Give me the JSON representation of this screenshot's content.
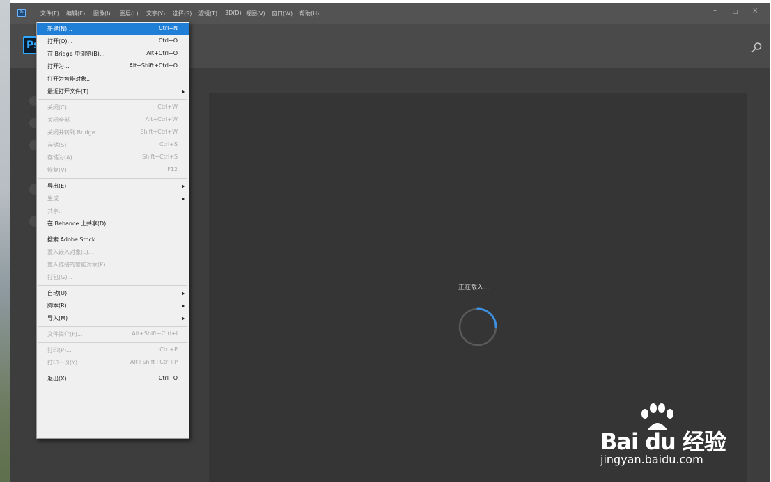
{
  "menubar": {
    "app_badge": "Ps",
    "items": [
      {
        "label": "文件(F)"
      },
      {
        "label": "编辑(E)"
      },
      {
        "label": "图像(I)"
      },
      {
        "label": "图层(L)"
      },
      {
        "label": "文字(Y)"
      },
      {
        "label": "选择(S)"
      },
      {
        "label": "滤镜(T)"
      },
      {
        "label": "3D(D)"
      },
      {
        "label": "视图(V)"
      },
      {
        "label": "窗口(W)"
      },
      {
        "label": "帮助(H)"
      }
    ],
    "window_controls": {
      "minimize": "–",
      "maximize": "□",
      "close": "×"
    }
  },
  "toolbar": {
    "logo": "Ps",
    "search_icon": "search-icon"
  },
  "file_menu": {
    "groups": [
      [
        {
          "label": "新建(N)...",
          "shortcut": "Ctrl+N",
          "state": "selected"
        },
        {
          "label": "打开(O)...",
          "shortcut": "Ctrl+O",
          "state": "enabled"
        },
        {
          "label": "在 Bridge 中浏览(B)...",
          "shortcut": "Alt+Ctrl+O",
          "state": "enabled"
        },
        {
          "label": "打开为...",
          "shortcut": "Alt+Shift+Ctrl+O",
          "state": "enabled"
        },
        {
          "label": "打开为智能对象...",
          "shortcut": "",
          "state": "enabled"
        },
        {
          "label": "最近打开文件(T)",
          "shortcut": "",
          "state": "enabled",
          "submenu": true
        }
      ],
      [
        {
          "label": "关闭(C)",
          "shortcut": "Ctrl+W",
          "state": "disabled"
        },
        {
          "label": "关闭全部",
          "shortcut": "Alt+Ctrl+W",
          "state": "disabled"
        },
        {
          "label": "关闭并转到 Bridge...",
          "shortcut": "Shift+Ctrl+W",
          "state": "disabled"
        },
        {
          "label": "存储(S)",
          "shortcut": "Ctrl+S",
          "state": "disabled"
        },
        {
          "label": "存储为(A)...",
          "shortcut": "Shift+Ctrl+S",
          "state": "disabled"
        },
        {
          "label": "恢复(V)",
          "shortcut": "F12",
          "state": "disabled"
        }
      ],
      [
        {
          "label": "导出(E)",
          "shortcut": "",
          "state": "enabled",
          "submenu": true
        },
        {
          "label": "生成",
          "shortcut": "",
          "state": "disabled",
          "submenu": true
        },
        {
          "label": "共享...",
          "shortcut": "",
          "state": "disabled"
        },
        {
          "label": "在 Behance 上共享(D)...",
          "shortcut": "",
          "state": "enabled"
        }
      ],
      [
        {
          "label": "搜索 Adobe Stock...",
          "shortcut": "",
          "state": "enabled"
        },
        {
          "label": "置入嵌入对象(L)...",
          "shortcut": "",
          "state": "disabled"
        },
        {
          "label": "置入链接的智能对象(K)...",
          "shortcut": "",
          "state": "disabled"
        },
        {
          "label": "打包(G)...",
          "shortcut": "",
          "state": "disabled"
        }
      ],
      [
        {
          "label": "自动(U)",
          "shortcut": "",
          "state": "enabled",
          "submenu": true
        },
        {
          "label": "脚本(R)",
          "shortcut": "",
          "state": "enabled",
          "submenu": true
        },
        {
          "label": "导入(M)",
          "shortcut": "",
          "state": "enabled",
          "submenu": true
        }
      ],
      [
        {
          "label": "文件简介(F)...",
          "shortcut": "Alt+Shift+Ctrl+I",
          "state": "disabled"
        }
      ],
      [
        {
          "label": "打印(P)...",
          "shortcut": "Ctrl+P",
          "state": "disabled"
        },
        {
          "label": "打印一份(Y)",
          "shortcut": "Alt+Shift+Ctrl+P",
          "state": "disabled"
        }
      ],
      [
        {
          "label": "退出(X)",
          "shortcut": "Ctrl+Q",
          "state": "enabled"
        }
      ]
    ]
  },
  "workspace": {
    "loading_text": "正在载入..."
  },
  "watermark": {
    "brand": "Bai du 经验",
    "url": "jingyan.baidu.com"
  },
  "colors": {
    "menu_highlight": "#1f7fd7",
    "accent_blue": "#31a8ff",
    "app_bg": "#444444"
  }
}
